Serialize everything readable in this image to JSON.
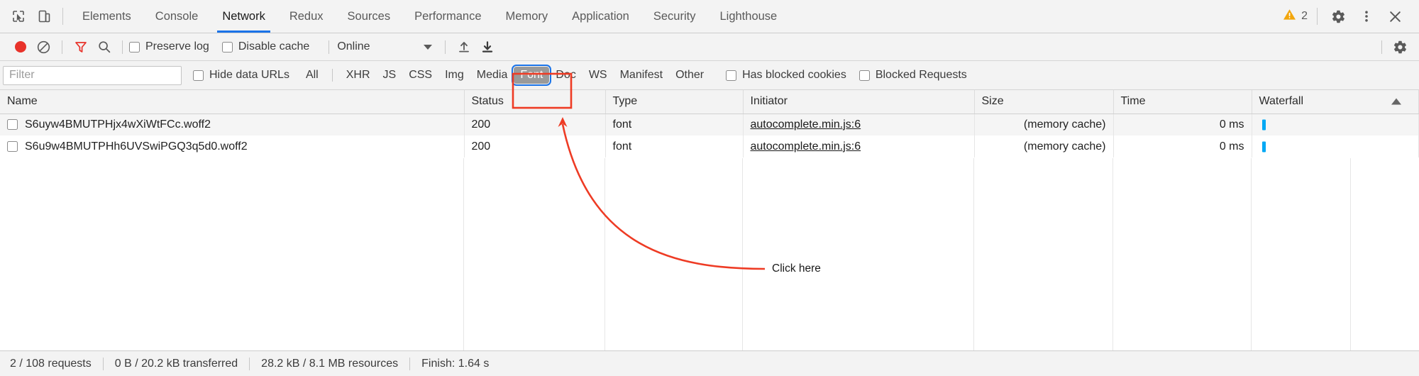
{
  "tabbar": {
    "icons": [
      {
        "name": "inspect-element-icon",
        "glyph": "inspect"
      },
      {
        "name": "device-toolbar-icon",
        "glyph": "device"
      }
    ],
    "tabs": [
      {
        "label": "Elements",
        "active": false
      },
      {
        "label": "Console",
        "active": false
      },
      {
        "label": "Network",
        "active": true
      },
      {
        "label": "Redux",
        "active": false
      },
      {
        "label": "Sources",
        "active": false
      },
      {
        "label": "Performance",
        "active": false
      },
      {
        "label": "Memory",
        "active": false
      },
      {
        "label": "Application",
        "active": false
      },
      {
        "label": "Security",
        "active": false
      },
      {
        "label": "Lighthouse",
        "active": false
      }
    ],
    "warning_count": "2",
    "right_buttons": [
      {
        "name": "settings-gear-button",
        "label": "Settings"
      },
      {
        "name": "more-options-button",
        "label": "More options"
      },
      {
        "name": "close-devtools-button",
        "label": "Close"
      }
    ],
    "accent_color": "#1a73e8",
    "warning_color": "#f2a60c"
  },
  "toolbar": {
    "record_button_label": "Record",
    "clear_button_label": "Clear",
    "filter_button_label": "Filter",
    "search_button_label": "Search",
    "preserve_log_label": "Preserve log",
    "preserve_log_checked": false,
    "disable_cache_label": "Disable cache",
    "disable_cache_checked": false,
    "throttling_value": "Online",
    "import_har_label": "Import HAR",
    "export_har_label": "Export HAR",
    "settings_label": "Network settings",
    "record_color": "#e8322a",
    "filter_active_color": "#e8322a"
  },
  "filterbar": {
    "filter_placeholder": "Filter",
    "filter_value": "",
    "hide_data_urls_label": "Hide data URLs",
    "hide_data_urls_checked": false,
    "types": [
      {
        "label": "All",
        "selected": false
      },
      {
        "label": "XHR",
        "selected": false
      },
      {
        "label": "JS",
        "selected": false
      },
      {
        "label": "CSS",
        "selected": false
      },
      {
        "label": "Img",
        "selected": false
      },
      {
        "label": "Media",
        "selected": false
      },
      {
        "label": "Font",
        "selected": true
      },
      {
        "label": "Doc",
        "selected": false
      },
      {
        "label": "WS",
        "selected": false
      },
      {
        "label": "Manifest",
        "selected": false
      },
      {
        "label": "Other",
        "selected": false
      }
    ],
    "has_blocked_cookies_label": "Has blocked cookies",
    "has_blocked_cookies_checked": false,
    "blocked_requests_label": "Blocked Requests",
    "blocked_requests_checked": false,
    "selected_chip_bg": "#9a9a9a",
    "selected_chip_outline": "#1a73e8"
  },
  "table": {
    "columns": [
      {
        "key": "name",
        "label": "Name"
      },
      {
        "key": "status",
        "label": "Status"
      },
      {
        "key": "type",
        "label": "Type"
      },
      {
        "key": "initiator",
        "label": "Initiator"
      },
      {
        "key": "size",
        "label": "Size"
      },
      {
        "key": "time",
        "label": "Time"
      },
      {
        "key": "waterfall",
        "label": "Waterfall"
      }
    ],
    "sort_column": "Waterfall",
    "sort_direction": "ascending",
    "rows": [
      {
        "name": "S6uyw4BMUTPHjx4wXiWtFCc.woff2",
        "status": "200",
        "type": "font",
        "initiator": "autocomplete.min.js:6",
        "size": "(memory cache)",
        "time": "0 ms",
        "waterfall_color": "#00a8f4"
      },
      {
        "name": "S6u9w4BMUTPHh6UVSwiPGQ3q5d0.woff2",
        "status": "200",
        "type": "font",
        "initiator": "autocomplete.min.js:6",
        "size": "(memory cache)",
        "time": "0 ms",
        "waterfall_color": "#00a8f4"
      }
    ]
  },
  "statusbar": {
    "items": [
      "2 / 108 requests",
      "0 B / 20.2 kB transferred",
      "28.2 kB / 8.1 MB resources",
      "Finish: 1.64 s"
    ]
  },
  "annotation": {
    "label": "Click here",
    "color": "#ee3b24",
    "highlight_target": "Font"
  }
}
